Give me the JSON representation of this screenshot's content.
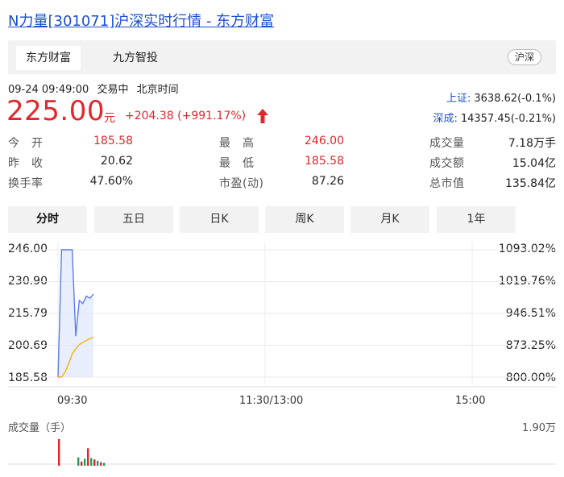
{
  "page": {
    "title": "N力量[301071]沪深实时行情 - 东方财富"
  },
  "source_tabs": [
    {
      "label": "东方财富",
      "active": true
    },
    {
      "label": "九方智投",
      "active": false
    }
  ],
  "market_pill": "沪深",
  "quote": {
    "datetime": "09-24 09:49:00",
    "status": "交易中",
    "timezone": "北京时间",
    "price": "225.00",
    "unit": "元",
    "change": "+204.38 (+991.17%)"
  },
  "indices": [
    {
      "name": "上证:",
      "value": "3638.62(-0.1%)"
    },
    {
      "name": "深成:",
      "value": "14357.45(-0.21%)"
    }
  ],
  "stats": {
    "open_label": "今　开",
    "open": "185.58",
    "prev_label": "昨　收",
    "prev": "20.62",
    "turnover_label": "换手率",
    "turnover": "47.60%",
    "high_label": "最　高",
    "high": "246.00",
    "low_label": "最　低",
    "low": "185.58",
    "pe_label": "市盈(动)",
    "pe": "87.26",
    "volume_label": "成交量",
    "volume": "7.18万手",
    "amount_label": "成交额",
    "amount": "15.04亿",
    "mcap_label": "总市值",
    "mcap": "135.84亿"
  },
  "period_tabs": [
    {
      "label": "分时",
      "active": true
    },
    {
      "label": "五日",
      "active": false
    },
    {
      "label": "日K",
      "active": false
    },
    {
      "label": "周K",
      "active": false
    },
    {
      "label": "月K",
      "active": false
    },
    {
      "label": "1年",
      "active": false
    }
  ],
  "colors": {
    "up": "#e4262b",
    "link": "#1a4fd1",
    "price_line": "#5b7de8",
    "avg_line": "#f5b400",
    "volume_up": "#e4262b",
    "volume_down": "#1fa15c"
  },
  "chart_data": {
    "type": "line",
    "y_left_ticks": [
      "246.00",
      "230.90",
      "215.79",
      "200.69",
      "185.58"
    ],
    "y_right_ticks": [
      "1093.02%",
      "1019.76%",
      "946.51%",
      "873.25%",
      "800.00%"
    ],
    "x_ticks": [
      "09:30",
      "11:30/13:00",
      "15:00"
    ],
    "ylim": [
      185.58,
      246.0
    ],
    "series": [
      {
        "values": [
          185.58,
          246.0,
          246.0,
          246.0,
          246.0,
          205.0,
          222.0,
          220.5,
          224.0,
          223.0,
          225.0
        ]
      },
      {
        "values": [
          185.58,
          185.58,
          188.0,
          192.0,
          196.5,
          199.0,
          201.0,
          202.0,
          203.0,
          203.8,
          204.5
        ]
      }
    ],
    "volume": {
      "label": "成交量（手）",
      "max_label": "1.90万",
      "bars": [
        {
          "value": 1.9,
          "dir": "up"
        },
        {
          "value": 0.6,
          "dir": "down"
        },
        {
          "value": 0.3,
          "dir": "up"
        },
        {
          "value": 0.5,
          "dir": "down"
        },
        {
          "value": 1.25,
          "dir": "up"
        },
        {
          "value": 0.55,
          "dir": "down"
        },
        {
          "value": 0.45,
          "dir": "up"
        },
        {
          "value": 0.35,
          "dir": "down"
        },
        {
          "value": 0.25,
          "dir": "up"
        },
        {
          "value": 0.2,
          "dir": "down"
        }
      ]
    }
  }
}
